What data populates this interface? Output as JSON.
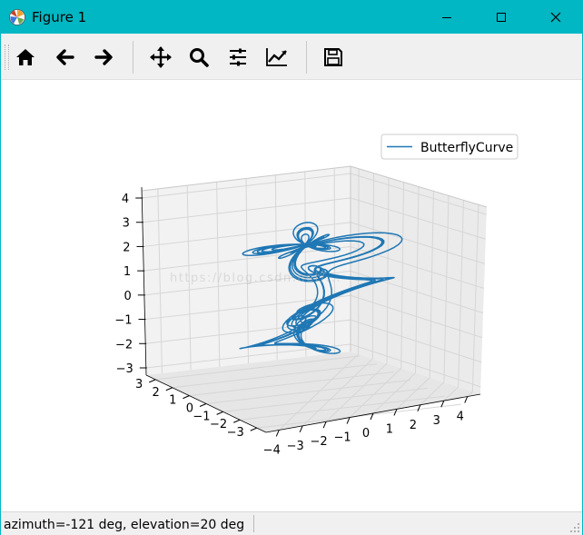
{
  "window": {
    "title": "Figure 1",
    "app_icon": "matplotlib-icon",
    "controls": {
      "minimize_icon": "minimize-icon",
      "maximize_icon": "maximize-icon",
      "close_icon": "close-icon"
    }
  },
  "toolbar": {
    "buttons": [
      {
        "id": "home",
        "icon": "home-icon"
      },
      {
        "id": "back",
        "icon": "arrow-left-icon"
      },
      {
        "id": "forward",
        "icon": "arrow-right-icon"
      },
      {
        "id": "pan",
        "icon": "move-arrows-icon"
      },
      {
        "id": "zoom",
        "icon": "magnifier-icon"
      },
      {
        "id": "subplots",
        "icon": "sliders-icon"
      },
      {
        "id": "customize",
        "icon": "line-chart-icon"
      },
      {
        "id": "save",
        "icon": "floppy-disk-icon"
      }
    ]
  },
  "status": {
    "text": "azimuth=-121 deg, elevation=20 deg"
  },
  "colors": {
    "titlebar": "#00b7c3",
    "line": "#1f77b4",
    "pane": "#f2f2f2",
    "grid": "#d9d9d9"
  },
  "chart_data": {
    "type": "line",
    "projection": "3d",
    "view": {
      "azimuth": -121,
      "elevation": 20
    },
    "series": [
      {
        "name": "ButterflyCurve"
      }
    ],
    "legend": "top-right",
    "grid": true,
    "axes": {
      "x": {
        "ticks": [
          "−4",
          "−3",
          "−2",
          "−1",
          "0",
          "1",
          "2",
          "3",
          "4"
        ],
        "range": [
          -4,
          4
        ]
      },
      "y": {
        "ticks": [
          "3",
          "2",
          "1",
          "0",
          "−1",
          "−2",
          "−3"
        ],
        "range": [
          -3,
          3
        ]
      },
      "z": {
        "ticks": [
          "4",
          "3",
          "2",
          "1",
          "0",
          "−1",
          "−2",
          "−3"
        ],
        "range": [
          -3,
          4
        ]
      }
    },
    "watermark": "https://blog.csdn.net/..."
  }
}
